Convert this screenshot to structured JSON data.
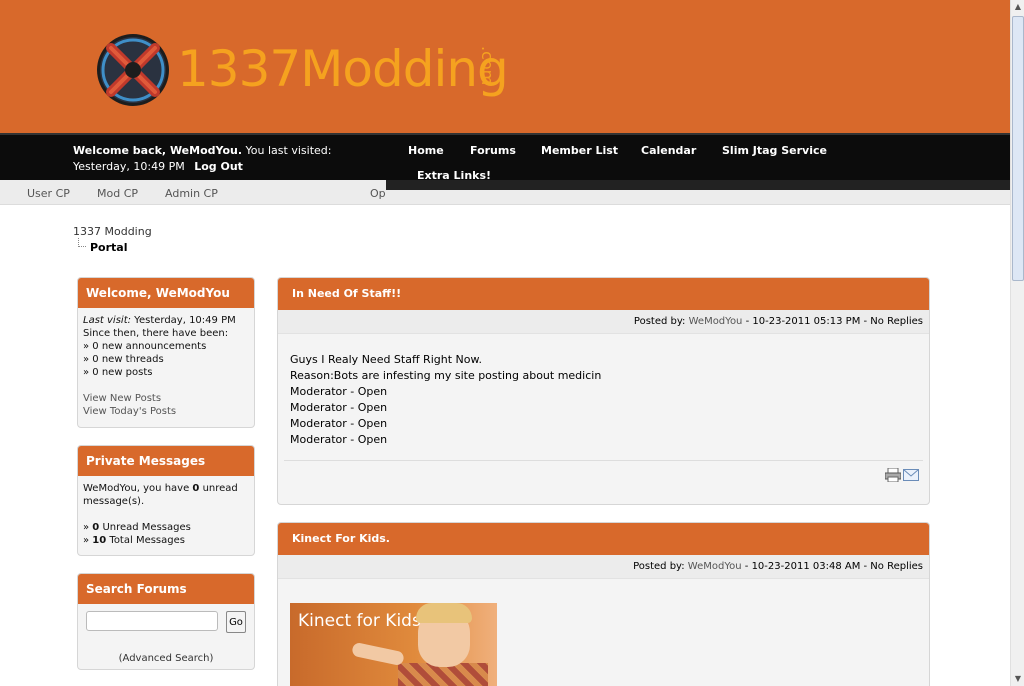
{
  "header": {
    "logo_text": "1337Modding",
    "logo_suffix": ".com"
  },
  "userbar": {
    "welcome_prefix": "Welcome back, WeModYou.",
    "last_visit": "You last visited: Yesterday, 10:49 PM",
    "logout": "Log Out"
  },
  "mainnav": {
    "home": "Home",
    "forums": "Forums",
    "member_list": "Member List",
    "calendar": "Calendar",
    "slim_jtag": "Slim Jtag Service",
    "extra_links": "Extra Links!"
  },
  "subnav": {
    "user_cp": "User CP",
    "mod_cp": "Mod CP",
    "admin_cp": "Admin CP",
    "op": "Op"
  },
  "breadcrumb": {
    "root": "1337 Modding",
    "current": "Portal"
  },
  "welcome_box": {
    "title": "Welcome, WeModYou",
    "last_visit_label": "Last visit:",
    "last_visit_value": "Yesterday, 10:49 PM",
    "since": "Since then, there have been:",
    "announcements": "» 0 new announcements",
    "threads": "» 0 new threads",
    "posts": "» 0 new posts",
    "view_new": "View New Posts",
    "view_today": "View Today's Posts"
  },
  "pm_box": {
    "title": "Private Messages",
    "text_pre": "WeModYou, you have ",
    "unread_count": "0",
    "text_post": " unread message(s).",
    "unread_line_count": "0",
    "unread_line_label": "Unread Messages",
    "total_line_count": "10",
    "total_line_label": "Total Messages"
  },
  "search_box": {
    "title": "Search Forums",
    "input_value": "",
    "go": "Go",
    "advanced": "Advanced Search"
  },
  "posts": [
    {
      "title": "In Need Of Staff!!",
      "meta_prefix": "Posted by:",
      "author": "WeModYou",
      "meta_suffix": "- 10-23-2011 05:13 PM - No Replies",
      "lines": [
        "Guys I Realy Need Staff Right Now.",
        "Reason:Bots are infesting my site posting about medicin",
        "Moderator - Open",
        "Moderator - Open",
        "Moderator - Open",
        "Moderator - Open"
      ]
    },
    {
      "title": "Kinect For Kids.",
      "meta_prefix": "Posted by:",
      "author": "WeModYou",
      "meta_suffix": "- 10-23-2011 03:48 AM - No Replies",
      "image_caption": "Kinect for Kids"
    }
  ],
  "colors": {
    "brand_orange": "#d8692b",
    "logo_yellow": "#f5a21f",
    "nav_black": "#0c0c0c"
  }
}
